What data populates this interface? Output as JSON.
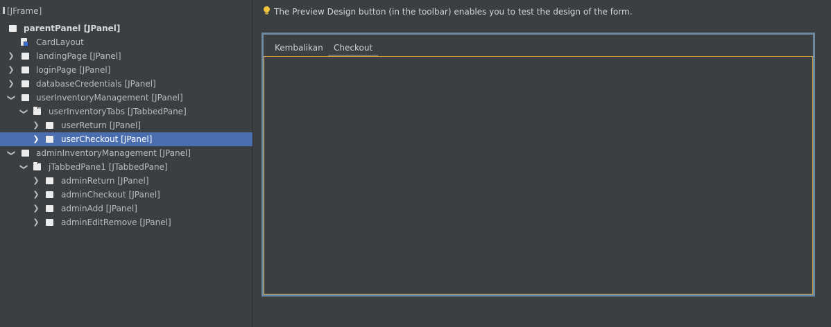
{
  "navigator": {
    "nodes": [
      {
        "label": "[JFrame]"
      },
      {
        "label": "parentPanel [JPanel]"
      },
      {
        "label": "CardLayout"
      },
      {
        "label": "landingPage [JPanel]"
      },
      {
        "label": "loginPage [JPanel]"
      },
      {
        "label": "databaseCredentials [JPanel]"
      },
      {
        "label": "userInventoryManagement [JPanel]"
      },
      {
        "label": "userInventoryTabs [JTabbedPane]"
      },
      {
        "label": "userReturn [JPanel]"
      },
      {
        "label": "userCheckout [JPanel]"
      },
      {
        "label": "adminInventoryManagement [JPanel]"
      },
      {
        "label": "jTabbedPane1 [JTabbedPane]"
      },
      {
        "label": "adminReturn [JPanel]"
      },
      {
        "label": "adminCheckout [JPanel]"
      },
      {
        "label": "adminAdd [JPanel]"
      },
      {
        "label": "adminEditRemove [JPanel]"
      }
    ]
  },
  "hint": {
    "text": "The Preview Design button (in the toolbar) enables you to test the design of the form.",
    "icon": "lightbulb-icon",
    "icon_color": "#f0c53a"
  },
  "form": {
    "tabs": [
      {
        "label": "Kembalikan"
      },
      {
        "label": "Checkout"
      }
    ],
    "selected_tab": "Checkout",
    "frame_color": "#6e8aa3",
    "selection_color": "#d3a53c"
  },
  "colors": {
    "background": "#3c3f41",
    "tree_selection": "#4b6eaf",
    "text": "#bbbbbb"
  }
}
